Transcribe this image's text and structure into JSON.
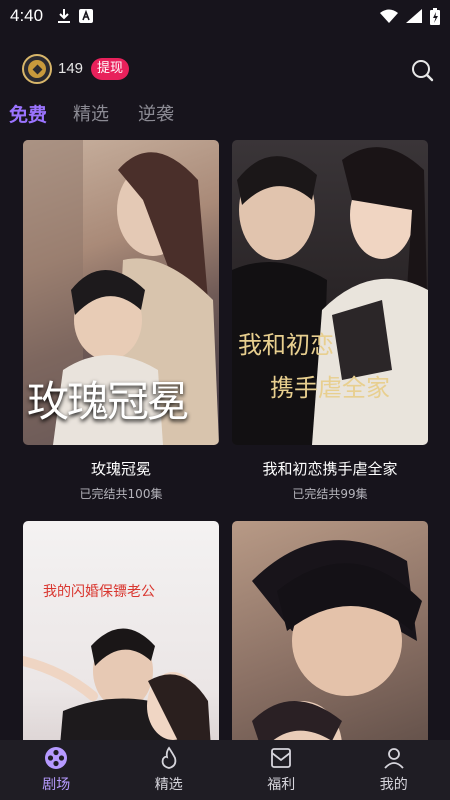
{
  "status_bar": {
    "time": "4:40"
  },
  "header": {
    "coins": "149",
    "withdraw_label": "提现"
  },
  "tabs": [
    {
      "label": "免费",
      "active": true
    },
    {
      "label": "精选",
      "active": false
    },
    {
      "label": "逆袭",
      "active": false
    }
  ],
  "dramas": [
    {
      "title": "玫瑰冠冕",
      "meta": "已完结共100集",
      "poster_text": "玫瑰冠冕"
    },
    {
      "title": "我和初恋携手虐全家",
      "meta": "已完结共99集",
      "poster_text_1": "我和初恋",
      "poster_text_2": "携手虐全家"
    },
    {
      "title": "",
      "meta": "",
      "poster_text": "我的闪婚保镖老公"
    },
    {
      "title": "",
      "meta": ""
    }
  ],
  "bottom_nav": [
    {
      "label": "剧场",
      "icon": "theater-icon",
      "active": true
    },
    {
      "label": "精选",
      "icon": "flame-icon",
      "active": false
    },
    {
      "label": "福利",
      "icon": "gift-envelope-icon",
      "active": false
    },
    {
      "label": "我的",
      "icon": "person-icon",
      "active": false
    }
  ],
  "colors": {
    "background": "#17141c",
    "accent": "#9b74ff",
    "withdraw_badge": "#e8215b",
    "coin_gold": "#c99a3c"
  }
}
